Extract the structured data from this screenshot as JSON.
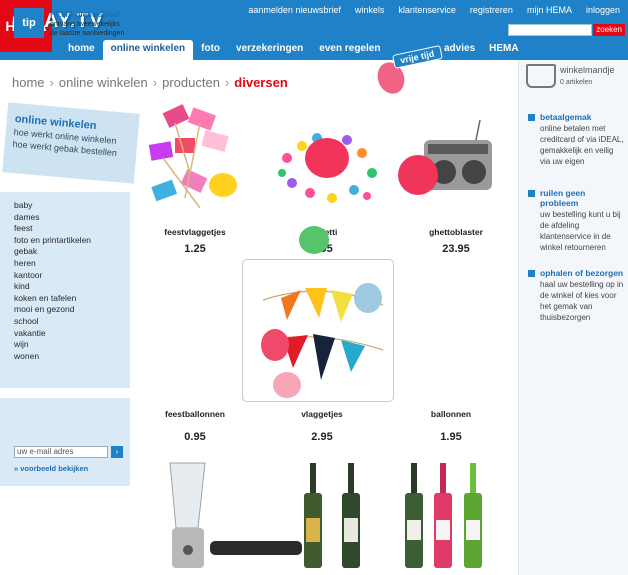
{
  "brand": {
    "logo": "HEMA",
    "watermark": "OHAY.TV"
  },
  "top_links": [
    "aanmelden nieuwsbrief",
    "winkels",
    "klantenservice",
    "registreren",
    "mijn HEMA",
    "inloggen"
  ],
  "search": {
    "button": "zoeken"
  },
  "nav": {
    "tabs": [
      "home",
      "online winkelen",
      "foto",
      "verzekeringen",
      "even regelen"
    ],
    "extra_tabs": [
      "advies",
      "HEMA"
    ],
    "badge": "vrije tijd"
  },
  "breadcrumb": [
    "home",
    "online winkelen",
    "producten",
    "diversen"
  ],
  "shop_card": {
    "title": "online winkelen",
    "lines": [
      "hoe werkt online winkelen",
      "hoe werkt gebak bestellen"
    ]
  },
  "categories": [
    "baby",
    "dames",
    "feest",
    "foto en printartikelen",
    "gebak",
    "heren",
    "kantoor",
    "kind",
    "koken en tafelen",
    "mooi en gezond",
    "school",
    "vakantie",
    "wijn",
    "wonen"
  ],
  "tip": {
    "icon": "tip",
    "title": "HEMA nieuwsbrief",
    "text": "ontvang tweewekelijks de laatste aanbiedingen",
    "email_placeholder": "uw e-mail adres",
    "voorbeeld": "voorbeeld bekijken"
  },
  "basket": {
    "title": "winkelmandje",
    "count": "0 artikelen",
    "icon": "basket-icon"
  },
  "usps": [
    {
      "head": "betaalgemak",
      "text": "online betalen met creditcard of via iDEAL, gemakkelijk en veilig via uw eigen"
    },
    {
      "head": "ruilen geen probleem",
      "text": "uw bestelling kunt u bij de afdeling klantenservice in de winkel retourneren"
    },
    {
      "head": "ophalen of bezorgen",
      "text": "haal uw bestelling op in de winkel of kies voor het gemak van thuisbezorgen"
    }
  ],
  "products": [
    {
      "name": "feestvlaggetjes",
      "price": "1.25"
    },
    {
      "name": "confetti",
      "price": "1.95"
    },
    {
      "name": "ghettoblaster",
      "price": "23.95"
    },
    {
      "name": "feestballonnen",
      "price": "0.95"
    },
    {
      "name": "vlaggetjes",
      "price": "2.95"
    },
    {
      "name": "ballonnen",
      "price": "1.95"
    }
  ],
  "colors": {
    "header_blue": "#1f82c8",
    "hema_red": "#e30613",
    "sidebar_blue": "#d9e9f5",
    "link_blue": "#1f6fb4"
  }
}
